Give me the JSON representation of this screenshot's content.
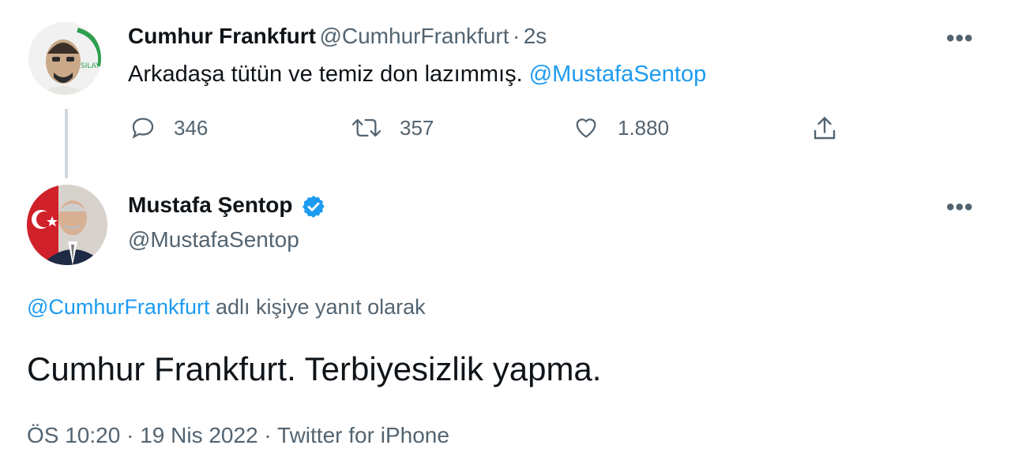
{
  "tweet1": {
    "name": "Cumhur Frankfurt",
    "handle": "@CumhurFrankfurt",
    "sep": "·",
    "time": "2s",
    "text": "Arkadaşa tütün ve temiz don lazımmış.",
    "mention": "@MustafaSentop",
    "replies": "346",
    "retweets": "357",
    "likes": "1.880",
    "more": "•••",
    "avatar_badge": "SILAY"
  },
  "tweet2": {
    "name": "Mustafa Şentop",
    "handle": "@MustafaSentop",
    "more": "•••",
    "reply_to_mention": "@CumhurFrankfurt",
    "reply_to_suffix": "adlı kişiye yanıt olarak",
    "text": "Cumhur Frankfurt. Terbiyesizlik yapma.",
    "time": "ÖS 10:20",
    "sep1": "·",
    "date": "19 Nis 2022",
    "sep2": "·",
    "source": "Twitter for iPhone"
  },
  "icons": {
    "reply": "reply-icon",
    "retweet": "retweet-icon",
    "like": "heart-icon",
    "share": "share-icon",
    "verified": "verified-badge-icon"
  },
  "colors": {
    "accent": "#1d9bf0",
    "secondary_text": "#536471",
    "primary_text": "#0f1419",
    "thread_line": "#cfd9de"
  }
}
